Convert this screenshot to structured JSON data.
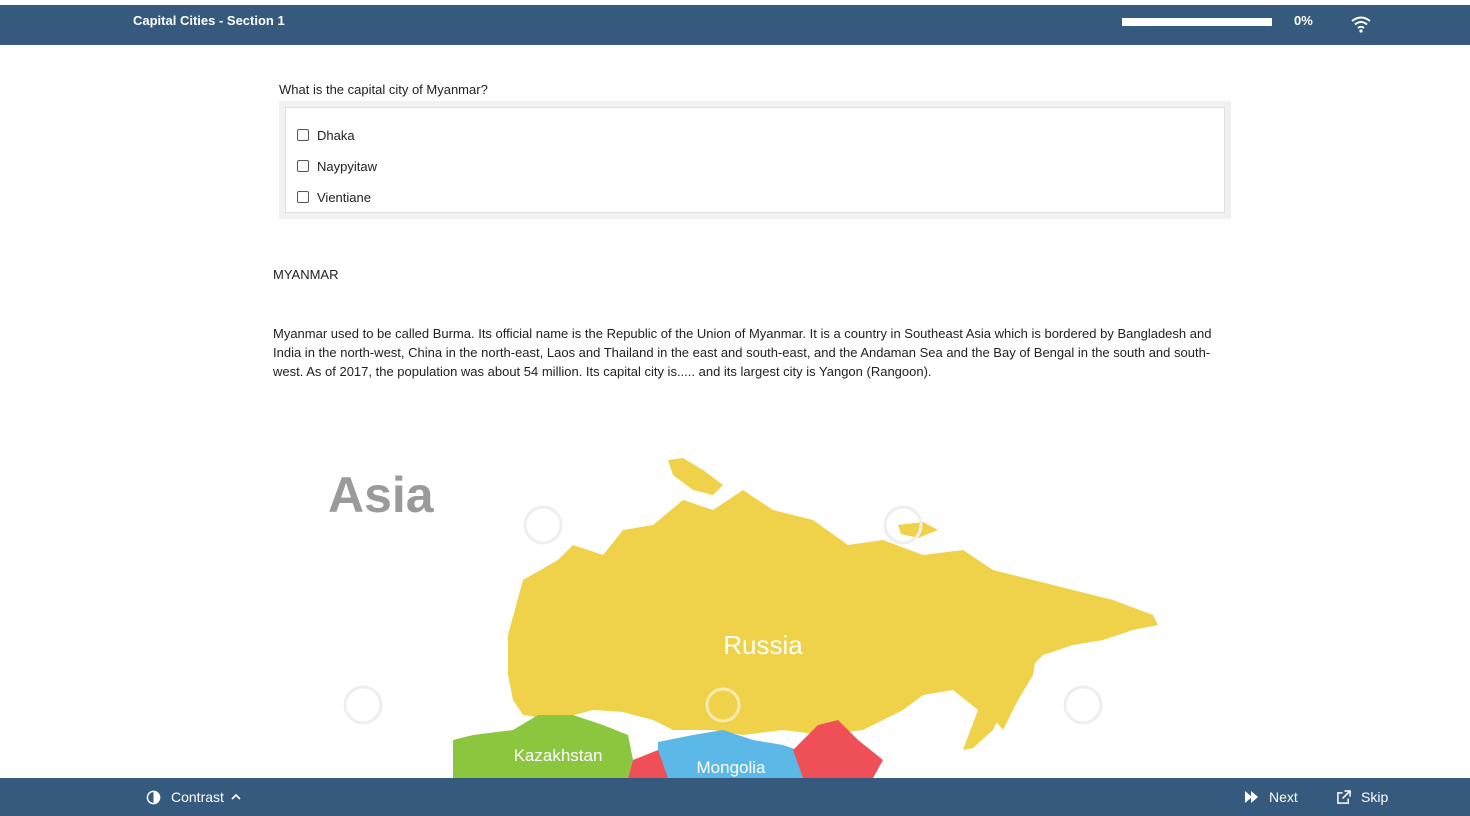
{
  "header": {
    "title": "Capital Cities - Section 1",
    "progress_label": "0%",
    "progress_value": 0
  },
  "question": {
    "text": "What is the capital city of Myanmar?",
    "options": [
      {
        "label": "Dhaka",
        "checked": false
      },
      {
        "label": "Naypyitaw",
        "checked": false
      },
      {
        "label": "Vientiane",
        "checked": false
      }
    ]
  },
  "content": {
    "heading": "MYANMAR",
    "paragraph": "Myanmar used to be called Burma. Its official name is the Republic of the Union of Myanmar. It is a country in Southeast Asia which is bordered by Bangladesh and India in the north-west, China in the north-east, Laos and Thailand in the east and south-east, and the Andaman Sea and the Bay of Bengal in the south and south-west. As of 2017, the population was about 54 million. Its capital city is..... and its largest city is Yangon (Rangoon)."
  },
  "map": {
    "title": "Asia",
    "labels": {
      "russia": "Russia",
      "kazakhstan": "Kazakhstan",
      "mongolia": "Mongolia"
    },
    "colors": {
      "russia": "#f0d24a",
      "kazakhstan": "#8cc63f",
      "mongolia": "#5cb8e6",
      "china": "#ef4f57"
    }
  },
  "footer": {
    "contrast_label": "Contrast",
    "next_label": "Next",
    "skip_label": "Skip"
  },
  "colors": {
    "bar": "#365a7d"
  }
}
